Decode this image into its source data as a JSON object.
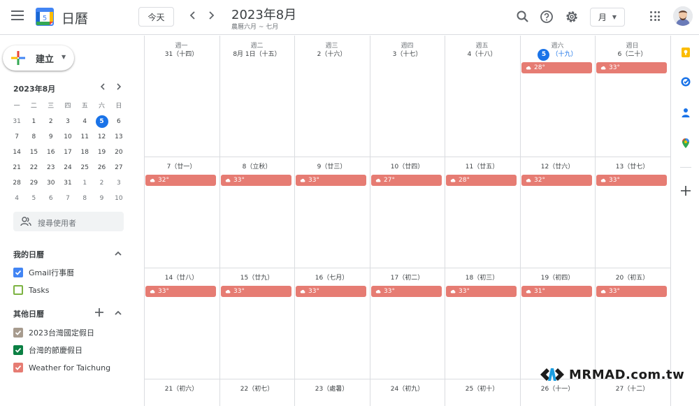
{
  "header": {
    "app_title": "日曆",
    "logo_day": "5",
    "today_label": "今天",
    "prev_icon": "chevron-left-icon",
    "next_icon": "chevron-right-icon",
    "month_title": "2023年8月",
    "lunar_subtitle": "農曆六月 ~ 七月",
    "view_label": "月",
    "icons": [
      "search-icon",
      "help-icon",
      "settings-icon",
      "apps-grid-icon"
    ]
  },
  "sidebar": {
    "create_label": "建立",
    "mini_calendar": {
      "title": "2023年8月",
      "weekdays": [
        "一",
        "二",
        "三",
        "四",
        "五",
        "六",
        "日"
      ],
      "weeks": [
        [
          "31",
          "1",
          "2",
          "3",
          "4",
          "5",
          "6"
        ],
        [
          "7",
          "8",
          "9",
          "10",
          "11",
          "12",
          "13"
        ],
        [
          "14",
          "15",
          "16",
          "17",
          "18",
          "19",
          "20"
        ],
        [
          "21",
          "22",
          "23",
          "24",
          "25",
          "26",
          "27"
        ],
        [
          "28",
          "29",
          "30",
          "31",
          "1",
          "2",
          "3"
        ],
        [
          "4",
          "5",
          "6",
          "7",
          "8",
          "9",
          "10"
        ]
      ],
      "today": "5"
    },
    "search_people_placeholder": "搜尋使用者",
    "my_calendars_title": "我的日曆",
    "my_calendars": [
      {
        "label": "Gmail行事曆",
        "color": "#4285f4",
        "checked": true
      },
      {
        "label": "Tasks",
        "color": "#7cb342",
        "checked": false
      }
    ],
    "other_calendars_title": "其他日曆",
    "other_calendars": [
      {
        "label": "2023台灣國定假日",
        "color": "#a79b8e",
        "checked": true
      },
      {
        "label": "台灣的節慶假日",
        "color": "#0b8043",
        "checked": true
      },
      {
        "label": "Weather for Taichung",
        "color": "#e67c73",
        "checked": true
      }
    ]
  },
  "month": {
    "weekdays": [
      "週一",
      "週二",
      "週三",
      "週四",
      "週五",
      "週六",
      "週日"
    ],
    "weeks": [
      {
        "days": [
          "31（十四）",
          "8月 1日（十五）",
          "2（十六）",
          "3（十七）",
          "4（十八）",
          "5",
          "6（二十）"
        ],
        "weather": [
          "",
          "",
          "",
          "",
          "",
          "28°",
          "33°"
        ]
      },
      {
        "days": [
          "7（廿一）",
          "8（立秋）",
          "9（廿三）",
          "10（廿四）",
          "11（廿五）",
          "12（廿六）",
          "13（廿七）"
        ],
        "weather": [
          "32°",
          "33°",
          "33°",
          "27°",
          "28°",
          "32°",
          "33°"
        ]
      },
      {
        "days": [
          "14（廿八）",
          "15（廿九）",
          "16（七月）",
          "17（初二）",
          "18（初三）",
          "19（初四）",
          "20（初五）"
        ],
        "weather": [
          "33°",
          "33°",
          "33°",
          "33°",
          "33°",
          "31°",
          "33°"
        ]
      },
      {
        "days": [
          "21（初六）",
          "22（初七）",
          "23（處暑）",
          "24（初九）",
          "25（初十）",
          "26（十一）",
          "27（十二）"
        ],
        "weather": [
          "",
          "",
          "",
          "",
          "",
          "",
          ""
        ]
      }
    ],
    "today_lunar": "（十九）",
    "weather_color": "#e67c73"
  },
  "watermark": {
    "text": "MRMAD.com.tw"
  },
  "colors": {
    "accent": "#1a73e8",
    "border": "#dadce0",
    "weather": "#e67c73"
  }
}
